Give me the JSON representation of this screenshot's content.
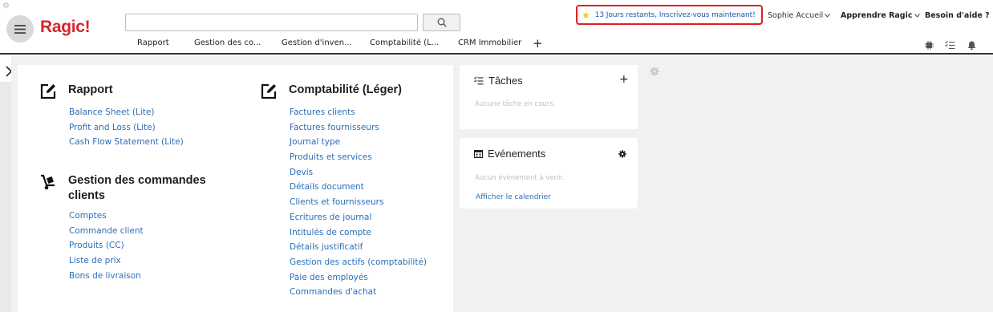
{
  "app": {
    "logo_text": "Ragic!"
  },
  "search": {
    "placeholder": "",
    "button_icon": "search-icon"
  },
  "tabs": [
    {
      "label": "Rapport"
    },
    {
      "label": "Gestion des co..."
    },
    {
      "label": "Gestion d'inven..."
    },
    {
      "label": "Comptabilité (L..."
    },
    {
      "label": "CRM Immobilier"
    }
  ],
  "tab_add_label": "+",
  "header": {
    "trial_text": "13 Jours restants, Inscrivez-vous maintenant!",
    "user_name": "Sophie Accueil",
    "learn_label": "Apprendre Ragic",
    "help_label": "Besoin d'aide ?"
  },
  "sections": {
    "rapport": {
      "title": "Rapport",
      "items": [
        "Balance Sheet (Lite)",
        "Profit and Loss (Lite)",
        "Cash Flow Statement (Lite)"
      ]
    },
    "commandes": {
      "title_line1": "Gestion des commandes",
      "title_line2": "clients",
      "items": [
        "Comptes",
        "Commande client",
        "Produits (CC)",
        "Liste de prix",
        "Bons de livraison"
      ]
    },
    "comptabilite": {
      "title": "Comptabilité (Léger)",
      "items": [
        "Factures clients",
        "Factures fournisseurs",
        "Journal type",
        "Produits et services",
        "Devis",
        "Détails document",
        "Clients et fournisseurs",
        "Ecritures de journal",
        "Intitulés de compte",
        "Détails justificatif",
        "Gestion des actifs (comptabilité)",
        "Paie des employés",
        "Commandes d'achat"
      ]
    }
  },
  "tasks": {
    "title": "Tâches",
    "empty_text": "Aucune tâche en cours.",
    "add_label": "+"
  },
  "events": {
    "title": "Evénements",
    "empty_text": "Aucun événement à venir.",
    "calendar_link": "Afficher le calendrier"
  },
  "colors": {
    "logo": "#d9232d",
    "link": "#2a6fb6",
    "banner_border": "#e01f26",
    "banner_text": "#1a56a8"
  }
}
